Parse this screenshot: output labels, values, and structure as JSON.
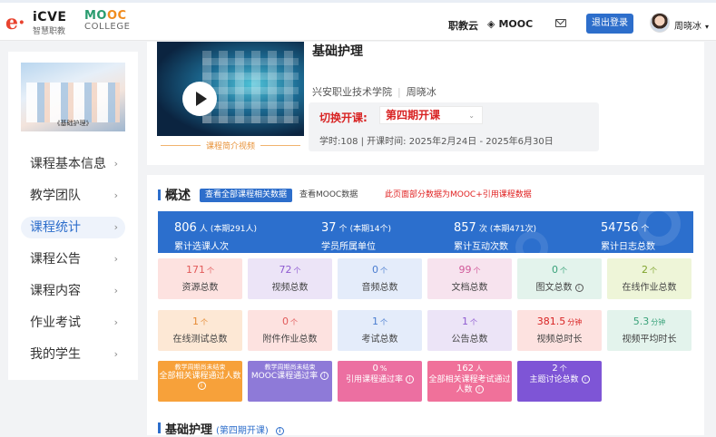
{
  "header": {
    "logo_mark": "e·",
    "logo_main": "iCVE",
    "logo_sub": "智慧职教",
    "mooc_part1": "MO",
    "mooc_part2": "OC",
    "mooc_sub": "COLLEGE",
    "nav_zhijiaoyun": "职教云",
    "nav_mooc_icon": "◈",
    "nav_mooc": "MOOC",
    "logout_label": "退出登录",
    "user_name": "周晓冰",
    "user_caret": "▾"
  },
  "sidebar": {
    "thumb_caption": "《基础护理》",
    "items": [
      {
        "label": "课程基本信息",
        "active": false
      },
      {
        "label": "教学团队",
        "active": false
      },
      {
        "label": "课程统计",
        "active": true
      },
      {
        "label": "课程公告",
        "active": false
      },
      {
        "label": "课程内容",
        "active": false
      },
      {
        "label": "作业考试",
        "active": false
      },
      {
        "label": "我的学生",
        "active": false
      }
    ],
    "chevron": "›"
  },
  "course": {
    "title": "基础护理",
    "video_label": "课程简介视频",
    "school": "兴安职业技术学院",
    "teacher": "周晓冰",
    "term_label": "切换开课:",
    "term_value": "第四期开课",
    "term_caret": "⌄",
    "meta": "学时:108 | 开课时间: 2025年2月24日 - 2025年6月30日"
  },
  "overview": {
    "title": "概述",
    "btn_all": "查看全部课程相关数据",
    "btn_mooc": "查看MOOC数据",
    "notice": "此页面部分数据为MOOC+引用课程数据",
    "banner": [
      {
        "num": "806",
        "unit": "人",
        "sub": "(本期291人)",
        "label": "累计选课人次"
      },
      {
        "num": "37",
        "unit": "个",
        "sub": "(本期14个)",
        "label": "学员所属单位"
      },
      {
        "num": "857",
        "unit": "次",
        "sub": "(本期471次)",
        "label": "累计互动次数"
      },
      {
        "num": "54756",
        "unit": "个",
        "sub": "",
        "label": "累计日志总数"
      }
    ],
    "row1": [
      {
        "value": "171",
        "unit": "个",
        "label": "资源总数",
        "bg": "#fde2e0",
        "color": "#e25a5a",
        "info": false
      },
      {
        "value": "72",
        "unit": "个",
        "label": "视频总数",
        "bg": "#ece4f7",
        "color": "#8f5bd1",
        "info": false
      },
      {
        "value": "0",
        "unit": "个",
        "label": "音频总数",
        "bg": "#e4ecfa",
        "color": "#4a7dd0",
        "info": false
      },
      {
        "value": "99",
        "unit": "个",
        "label": "文档总数",
        "bg": "#f7e3ee",
        "color": "#d15a9a",
        "info": false
      },
      {
        "value": "0",
        "unit": "个",
        "label": "图文总数",
        "bg": "#e3f3ec",
        "color": "#3aa27a",
        "info": true
      },
      {
        "value": "2",
        "unit": "个",
        "label": "在线作业总数",
        "bg": "#eef5d8",
        "color": "#7fa32c",
        "info": false
      }
    ],
    "row2": [
      {
        "value": "1",
        "unit": "个",
        "label": "在线测试总数",
        "bg": "#fde8d5",
        "color": "#e58a33",
        "info": false
      },
      {
        "value": "0",
        "unit": "个",
        "label": "附件作业总数",
        "bg": "#fde2e0",
        "color": "#e25a5a",
        "info": false
      },
      {
        "value": "1",
        "unit": "个",
        "label": "考试总数",
        "bg": "#e4ecfa",
        "color": "#4a7dd0",
        "info": false
      },
      {
        "value": "1",
        "unit": "个",
        "label": "公告总数",
        "bg": "#ece4f7",
        "color": "#8f5bd1",
        "info": false
      },
      {
        "value": "381.5",
        "unit": "分钟",
        "label": "视频总时长",
        "bg": "#fde2e0",
        "color": "#d82323",
        "info": false
      },
      {
        "value": "5.3",
        "unit": "分钟",
        "label": "视频平均时长",
        "bg": "#e3f3ec",
        "color": "#3aa27a",
        "info": false
      }
    ],
    "row3": [
      {
        "small": "教学周期尚未结束",
        "label": "全部相关课程通过人数",
        "value": "",
        "unit": "",
        "bg": "#f7a13a"
      },
      {
        "small": "教学周期尚未结束",
        "label": "MOOC课程通过率",
        "value": "",
        "unit": "",
        "bg": "#8e7ad8"
      },
      {
        "small": "",
        "label": "引用课程通过率",
        "value": "0",
        "unit": "%",
        "bg": "#ec6fa1"
      },
      {
        "small": "",
        "label": "全部相关课程考试通过人数",
        "value": "162",
        "unit": "人",
        "bg": "#f0719a"
      },
      {
        "small": "",
        "label": "主题讨论总数",
        "value": "2",
        "unit": "个",
        "bg": "#7e55d6"
      }
    ],
    "info_glyph": "i"
  },
  "section2": {
    "title": "基础护理",
    "term": "(第四期开课)",
    "info_glyph": "i"
  },
  "colors": {
    "primary": "#2d6ecb",
    "alert": "#d82323",
    "banner": "#2c6fcd"
  }
}
